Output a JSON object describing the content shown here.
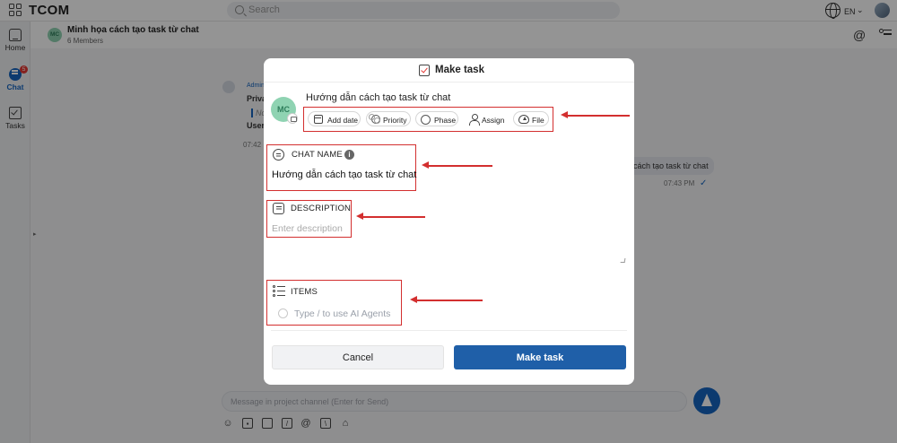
{
  "app": {
    "brand": "TCOM",
    "search_placeholder": "Search",
    "language": "EN"
  },
  "rail": {
    "items": [
      {
        "label": "Home"
      },
      {
        "label": "Chat",
        "badge": "5"
      },
      {
        "label": "Tasks"
      }
    ]
  },
  "channel": {
    "avatar_initials": "MC",
    "title": "Minh họa cách tạo task từ chat",
    "members": "6 Members"
  },
  "background": {
    "admin_prefix": "Admin",
    "line1": "Priva",
    "line2": "No",
    "line3": "User",
    "time_left": "07:42",
    "bubble_text": "cách tạo task từ chat",
    "time_right": "07:43 PM"
  },
  "composer": {
    "placeholder": "Message in project channel (Enter for Send)"
  },
  "modal": {
    "title": "Make task",
    "avatar_initials": "MC",
    "task_name": "Hướng dẫn cách tạo task từ chat",
    "actions": {
      "add_date": "Add date",
      "priority": "Priority",
      "phase": "Phase",
      "assign": "Assign",
      "file": "File"
    },
    "chat_name": {
      "label": "CHAT NAME",
      "value": "Hướng dẫn cách tạo task từ chat"
    },
    "description": {
      "label": "DESCRIPTION",
      "placeholder": "Enter description"
    },
    "items": {
      "label": "ITEMS",
      "placeholder": "Type / to use AI Agents"
    },
    "buttons": {
      "cancel": "Cancel",
      "make": "Make task"
    }
  },
  "colors": {
    "accent": "#1565c0",
    "primary_button": "#1f5fa8",
    "annotation_red": "#d32f2f",
    "avatar_green": "#8fd3b2"
  }
}
